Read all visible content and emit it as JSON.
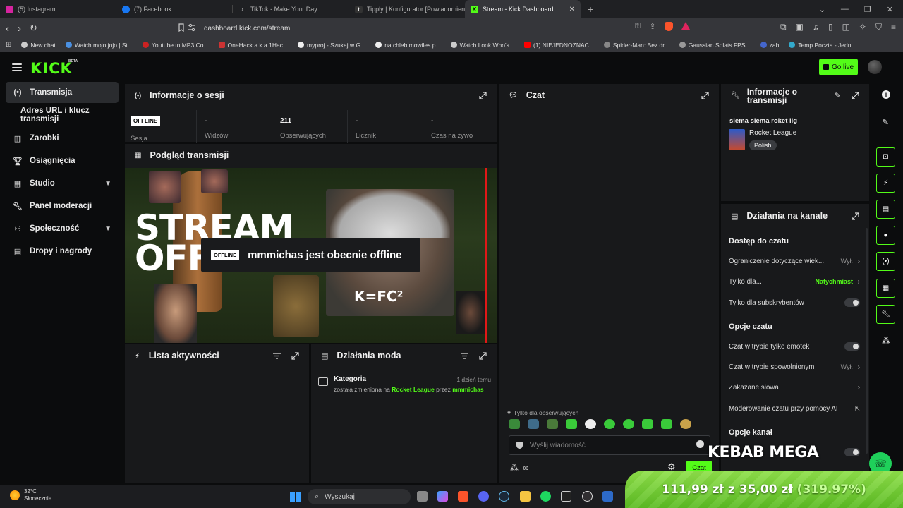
{
  "browser": {
    "tabs": [
      {
        "title": "(5) Instagram",
        "color": "#d6249f"
      },
      {
        "title": "(7) Facebook",
        "color": "#1877f2"
      },
      {
        "title": "TikTok - Make Your Day",
        "color": "#111111"
      },
      {
        "title": "Tipply | Konfigurator [Powiadomienia]",
        "color": "#222222"
      },
      {
        "title": "Stream - Kick Dashboard",
        "color": "#53fc18",
        "active": true
      }
    ],
    "url": "dashboard.kick.com/stream",
    "bookmarks": [
      {
        "label": "New chat",
        "color": "#cccccc"
      },
      {
        "label": "Watch mojo jojo | St...",
        "color": "#4a90e2"
      },
      {
        "label": "Youtube to MP3 Co...",
        "color": "#cc2222"
      },
      {
        "label": "OneHack a.k.a 1Hac...",
        "color": "#cc3333"
      },
      {
        "label": "myproj - Szukaj w G...",
        "color": "#eeeeee"
      },
      {
        "label": "na chleb mowiles p...",
        "color": "#eeeeee"
      },
      {
        "label": "Watch Look Who's...",
        "color": "#cccccc"
      },
      {
        "label": "(1) NIEJEDNOZNAC...",
        "color": "#ff0000"
      },
      {
        "label": "Spider-Man: Bez dr...",
        "color": "#888888"
      },
      {
        "label": "Gaussian Splats FPS...",
        "color": "#999999"
      },
      {
        "label": "zab",
        "color": "#4466cc"
      },
      {
        "label": "Temp Poczta - Jedn...",
        "color": "#33aacc"
      }
    ]
  },
  "header": {
    "logo": "KICK",
    "beta": "BETA",
    "go_live": "Go live"
  },
  "sidebar": {
    "items": [
      {
        "label": "Transmisja",
        "icon": "broadcast-icon",
        "active": true
      },
      {
        "label": "Adres URL i klucz transmisji",
        "icon": ""
      },
      {
        "label": "Zarobki",
        "icon": "chart-icon"
      },
      {
        "label": "Osiągnięcia",
        "icon": "trophy-icon"
      },
      {
        "label": "Studio",
        "icon": "studio-icon",
        "expand": true
      },
      {
        "label": "Panel moderacji",
        "icon": "wrench-icon"
      },
      {
        "label": "Społeczność",
        "icon": "community-icon",
        "expand": true
      },
      {
        "label": "Dropy i nagrody",
        "icon": "gift-icon"
      }
    ]
  },
  "session": {
    "title": "Informacje o sesji",
    "status": "OFFLINE",
    "stats": [
      {
        "value": "",
        "label": "Sesja"
      },
      {
        "value": "-",
        "label": "Widzów"
      },
      {
        "value": "211",
        "label": "Obserwujących"
      },
      {
        "value": "-",
        "label": "Licznik"
      },
      {
        "value": "-",
        "label": "Czas na żywo"
      }
    ]
  },
  "preview": {
    "title": "Podgląd transmisji",
    "big_text_1": "STREAM",
    "big_text_2": "OFF",
    "badge": "OFFLINE",
    "message": "mmmichas jest obecnie offline",
    "kfc": "K=FC²"
  },
  "activity": {
    "title": "Lista aktywności"
  },
  "mod_actions": {
    "title": "Działania moda",
    "entries": [
      {
        "heading": "Kategoria",
        "time": "1 dzień temu",
        "text_1": "została zmieniona na",
        "category": "Rocket League",
        "text_2": "przez",
        "user": "mmmichas"
      }
    ]
  },
  "chat": {
    "title": "Czat",
    "followers_only": "Tylko dla obserwujących",
    "placeholder": "Wyślij wiadomość",
    "send": "Czat"
  },
  "stream_info": {
    "title": "Informacje o transmisji",
    "stream_title": "siema siema roket lig",
    "category": "Rocket League",
    "language": "Polish"
  },
  "channel_actions": {
    "title": "Działania na kanale",
    "chat_access": "Dostęp do czatu",
    "age": {
      "label": "Ograniczenie dotyczące wiek...",
      "value": "Wył."
    },
    "only_for": {
      "label": "Tylko dla...",
      "value": "Natychmiast"
    },
    "subs_only": "Tylko dla subskrybentów",
    "chat_options": "Opcje czatu",
    "emote_mode": "Czat w trybie tylko emotek",
    "slow_mode": {
      "label": "Czat w trybie spowolnionym",
      "value": "Wył."
    },
    "banned_words": "Zakazane słowa",
    "ai_mod": "Moderowanie czatu przy pomocy AI",
    "channel_options": "Opcje kanał"
  },
  "overlay": {
    "kebab": "KEBAB MEGA",
    "price_now": "111,99 zł",
    "of": "z",
    "price_goal": "35,00 zł",
    "percent": "(319.97%)"
  },
  "taskbar": {
    "temp": "32°C",
    "weather": "Słonecznie",
    "search": "Wyszukaj"
  },
  "colors": {
    "accent": "#53fc18",
    "panel": "#18191b",
    "bg": "#0b0c0d"
  }
}
